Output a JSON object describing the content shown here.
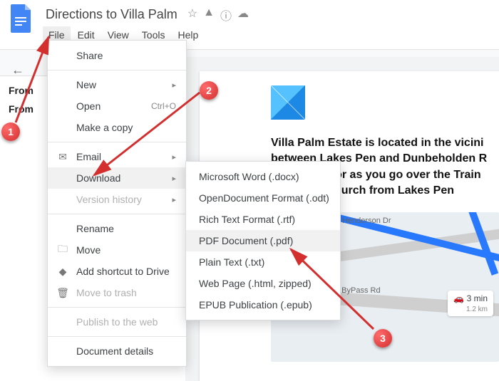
{
  "header": {
    "doc_title": "Directions to Villa Palm",
    "menus": {
      "file": "File",
      "edit": "Edit",
      "view": "View",
      "tools": "Tools",
      "help": "Help"
    }
  },
  "outline": {
    "item1": "From",
    "item2": "From"
  },
  "filemenu": {
    "share": "Share",
    "new": "New",
    "open": "Open",
    "open_shortcut": "Ctrl+O",
    "make_copy": "Make a copy",
    "email": "Email",
    "download": "Download",
    "version_history": "Version history",
    "rename": "Rename",
    "move": "Move",
    "add_shortcut": "Add shortcut to Drive",
    "move_trash": "Move to trash",
    "publish": "Publish to the web",
    "doc_details": "Document details"
  },
  "download_submenu": {
    "docx": "Microsoft Word (.docx)",
    "odt": "OpenDocument Format (.odt)",
    "rtf": "Rich Text Format (.rtf)",
    "pdf": "PDF Document (.pdf)",
    "txt": "Plain Text (.txt)",
    "html": "Web Page (.html, zipped)",
    "epub": "EPUB Publication (.epub)"
  },
  "document": {
    "body_text": "Villa Palm Estate is located in the vicini\nbetween Lakes Pen and Dunbeholden R\nWarehouse or as you go over the Train\nassembly Church from Lakes Pen"
  },
  "map": {
    "label1": "Henderson Dr",
    "label2": "n ByPass Rd",
    "badge_time": "3 min",
    "badge_dist": "1.2 km"
  },
  "callouts": {
    "c1": "1",
    "c2": "2",
    "c3": "3"
  }
}
